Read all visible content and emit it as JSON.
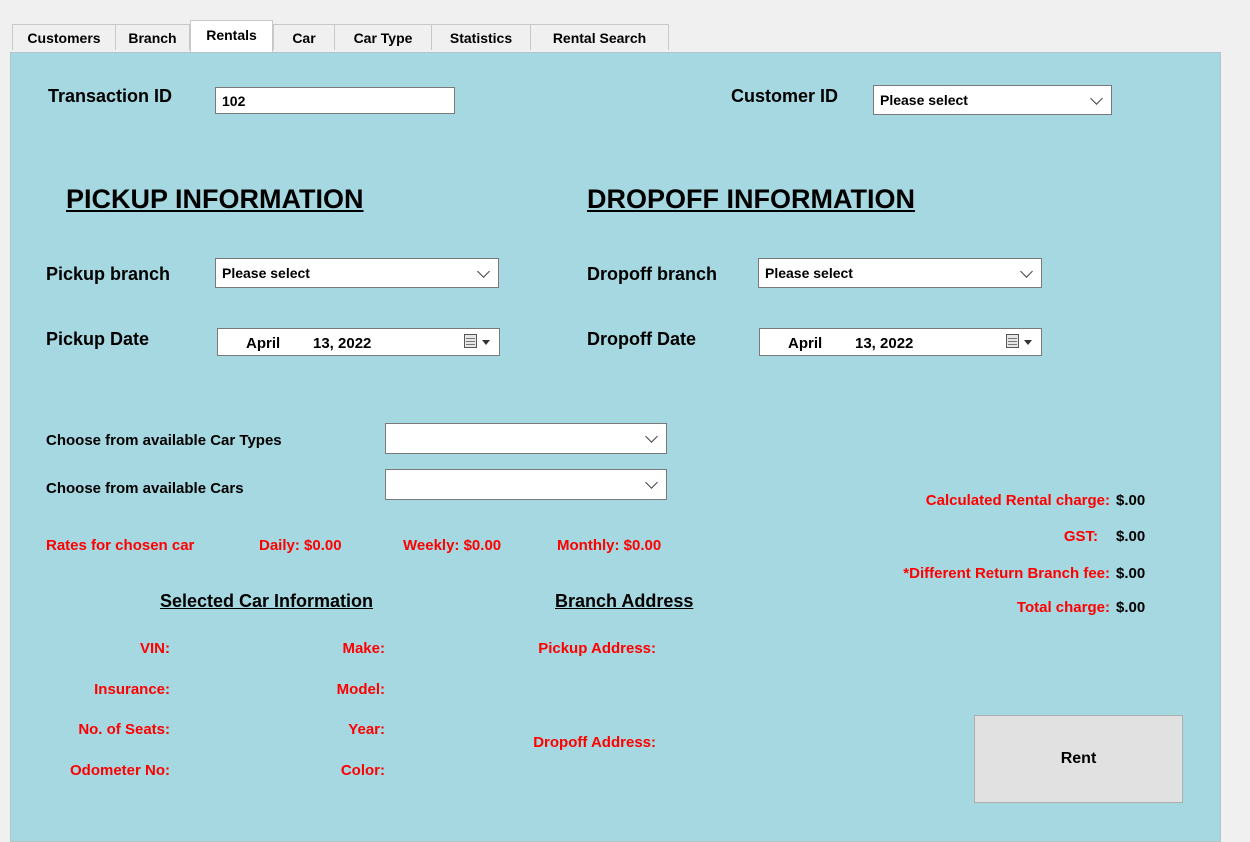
{
  "tabs": [
    {
      "label": "Customers"
    },
    {
      "label": "Branch"
    },
    {
      "label": "Rentals"
    },
    {
      "label": "Car"
    },
    {
      "label": "Car Type"
    },
    {
      "label": "Statistics"
    },
    {
      "label": "Rental Search"
    }
  ],
  "form": {
    "transaction_label": "Transaction ID",
    "transaction_value": "102",
    "customer_label": "Customer ID",
    "customer_value": "Please select"
  },
  "pickup": {
    "heading": "PICKUP INFORMATION",
    "branch_label": "Pickup branch",
    "branch_value": "Please select",
    "date_label": "Pickup Date",
    "date_month": "April",
    "date_day_year": "13, 2022"
  },
  "dropoff": {
    "heading": "DROPOFF INFORMATION",
    "branch_label": "Dropoff branch",
    "branch_value": "Please select",
    "date_label": "Dropoff Date",
    "date_month": "April",
    "date_day_year": "13, 2022"
  },
  "choose": {
    "car_types_label": "Choose from available Car Types",
    "car_types_value": "",
    "cars_label": "Choose from available Cars",
    "cars_value": ""
  },
  "rates": {
    "label": "Rates for chosen car",
    "daily": "Daily: $0.00",
    "weekly": "Weekly: $0.00",
    "monthly": "Monthly: $0.00"
  },
  "charges": {
    "rental_label": "Calculated Rental charge:",
    "rental_value": "$.00",
    "gst_label": "GST:",
    "gst_value": "$.00",
    "fee_label": "*Different Return Branch fee:",
    "fee_value": "$.00",
    "total_label": "Total charge:",
    "total_value": "$.00"
  },
  "car_info": {
    "heading": "Selected Car Information",
    "vin": "VIN:",
    "insurance": "Insurance:",
    "seats": "No. of Seats:",
    "odometer": "Odometer No:",
    "make": "Make:",
    "model": "Model:",
    "year": "Year:",
    "color": "Color:"
  },
  "branch_address": {
    "heading": "Branch Address",
    "pickup": "Pickup Address:",
    "dropoff": "Dropoff Address:"
  },
  "actions": {
    "rent_label": "Rent"
  },
  "colors": {
    "panel_bg": "#a5d8e0",
    "red_text": "#ff0000"
  }
}
